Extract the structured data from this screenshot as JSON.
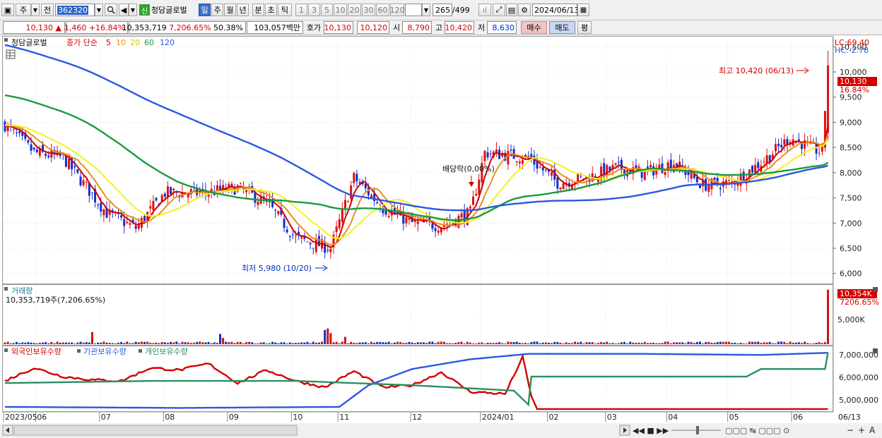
{
  "toolbar": {
    "tab_main": "주",
    "tab_prev": "전",
    "code": "362320",
    "name_badge": "신",
    "stock_name": "청담글로벌",
    "periods": [
      "일",
      "주",
      "월",
      "년",
      "분",
      "초",
      "틱"
    ],
    "minutes": [
      "1",
      "3",
      "5",
      "10",
      "20",
      "30",
      "60",
      "120"
    ],
    "count": "265",
    "count_total": "/499",
    "date": "2024/06/13"
  },
  "quote": {
    "price": "10,130",
    "up_mark": "▲",
    "change": "1,460",
    "change_pct": "+16.84%",
    "volume": "10,353,719",
    "volume_pct": "7,206.65%",
    "turnover": "50.38%",
    "amount": "103,057백만",
    "bid_label": "호가",
    "bid1": "10,130",
    "bid2": "10,120",
    "open_label": "시",
    "open": "8,790",
    "high_label": "고",
    "high": "10,420",
    "low_label": "저",
    "low": "8,630",
    "buy_btn": "매수",
    "sell_btn": "매도",
    "avg_btn": "평"
  },
  "price_panel": {
    "legend_name": "청담글로벌",
    "legend_type": "종가 단순",
    "ma_labels": [
      "5",
      "10",
      "20",
      "60",
      "120"
    ],
    "ma_colors": [
      "#d40000",
      "#e8901a",
      "#f6f020",
      "#1a9a40",
      "#2a58e0"
    ],
    "lc_label": "LC:69.40",
    "hc_label": "HC:-2.78",
    "y_ticks": [
      "10,500",
      "10,000",
      "9,500",
      "9,000",
      "8,500",
      "8,000",
      "7,500",
      "7,000",
      "6,500",
      "6,000"
    ],
    "high_annot": "최고 10,420 (06/13)",
    "low_annot": "최저 5,980 (10/20)",
    "div_annot": "배당락(0,00%)",
    "price_box": "10,130",
    "price_pct": "16.84%"
  },
  "volume_panel": {
    "title": "거래량",
    "value": "10,353,719주(7,206.65%)",
    "tick": "5,000K",
    "box": "10,354K",
    "box_pct": "7206.65%"
  },
  "holding_panel": {
    "legend": [
      "외국인보유수량",
      "기관보유수량",
      "개인보유수량"
    ],
    "legend_colors": [
      "#d40000",
      "#2a58e0",
      "#2a9060"
    ],
    "ticks": [
      "7,000,000",
      "6,000,000",
      "5,000,000"
    ]
  },
  "x_axis": {
    "labels": [
      "2023/05",
      "06",
      "07",
      "08",
      "09",
      "10",
      "11",
      "12",
      "2024/01",
      "02",
      "03",
      "04",
      "05",
      "06"
    ],
    "right": "06/13"
  },
  "chart_data": {
    "type": "candlestick",
    "ylim": [
      5800,
      10700
    ],
    "anchors": [
      [
        0,
        8950
      ],
      [
        10,
        8400
      ],
      [
        20,
        8300
      ],
      [
        35,
        7200
      ],
      [
        45,
        6900
      ],
      [
        55,
        7600
      ],
      [
        68,
        7600
      ],
      [
        80,
        7700
      ],
      [
        90,
        7400
      ],
      [
        100,
        6700
      ],
      [
        112,
        6500
      ],
      [
        120,
        7900
      ],
      [
        130,
        7300
      ],
      [
        140,
        7000
      ],
      [
        150,
        6950
      ],
      [
        160,
        7200
      ],
      [
        165,
        8400
      ],
      [
        180,
        8300
      ],
      [
        190,
        7800
      ],
      [
        200,
        7900
      ],
      [
        210,
        8100
      ],
      [
        220,
        8000
      ],
      [
        230,
        8200
      ],
      [
        240,
        7750
      ],
      [
        250,
        7800
      ],
      [
        260,
        8200
      ],
      [
        270,
        8700
      ],
      [
        277,
        8500
      ],
      [
        281,
        8400
      ],
      [
        283,
        10130
      ]
    ],
    "volume_spikes": [
      {
        "i": 30,
        "v": 2300
      },
      {
        "i": 74,
        "v": 1950
      },
      {
        "i": 75,
        "v": 1200
      },
      {
        "i": 110,
        "v": 2700
      },
      {
        "i": 111,
        "v": 3000
      },
      {
        "i": 112,
        "v": 2100
      },
      {
        "i": 117,
        "v": 1400
      },
      {
        "i": 283,
        "v": 10354
      }
    ],
    "holding_lines": [
      {
        "name": "외국인보유수량",
        "anchors": [
          [
            0,
            5700
          ],
          [
            10,
            6300
          ],
          [
            20,
            5900
          ],
          [
            30,
            5750
          ],
          [
            40,
            5700
          ],
          [
            50,
            6300
          ],
          [
            60,
            6200
          ],
          [
            70,
            6500
          ],
          [
            80,
            5600
          ],
          [
            90,
            6200
          ],
          [
            100,
            5700
          ],
          [
            110,
            5400
          ],
          [
            120,
            6150
          ],
          [
            130,
            5400
          ],
          [
            140,
            5500
          ],
          [
            150,
            6100
          ],
          [
            160,
            5200
          ],
          [
            172,
            5100
          ],
          [
            178,
            6800
          ],
          [
            181,
            5000
          ],
          [
            183,
            4400
          ],
          [
            283,
            4400
          ]
        ]
      },
      {
        "name": "기관보유수량",
        "anchors": [
          [
            0,
            4500
          ],
          [
            60,
            4450
          ],
          [
            115,
            4500
          ],
          [
            125,
            5500
          ],
          [
            140,
            6250
          ],
          [
            160,
            6700
          ],
          [
            180,
            6950
          ],
          [
            220,
            6950
          ],
          [
            260,
            6900
          ],
          [
            283,
            7000
          ]
        ]
      },
      {
        "name": "개인보유수량",
        "anchors": [
          [
            0,
            5600
          ],
          [
            50,
            5700
          ],
          [
            100,
            5700
          ],
          [
            140,
            5500
          ],
          [
            175,
            5250
          ],
          [
            180,
            4600
          ],
          [
            181,
            5900
          ],
          [
            230,
            5900
          ],
          [
            255,
            5900
          ],
          [
            260,
            6250
          ],
          [
            282,
            6250
          ],
          [
            283,
            7000
          ]
        ]
      }
    ]
  }
}
